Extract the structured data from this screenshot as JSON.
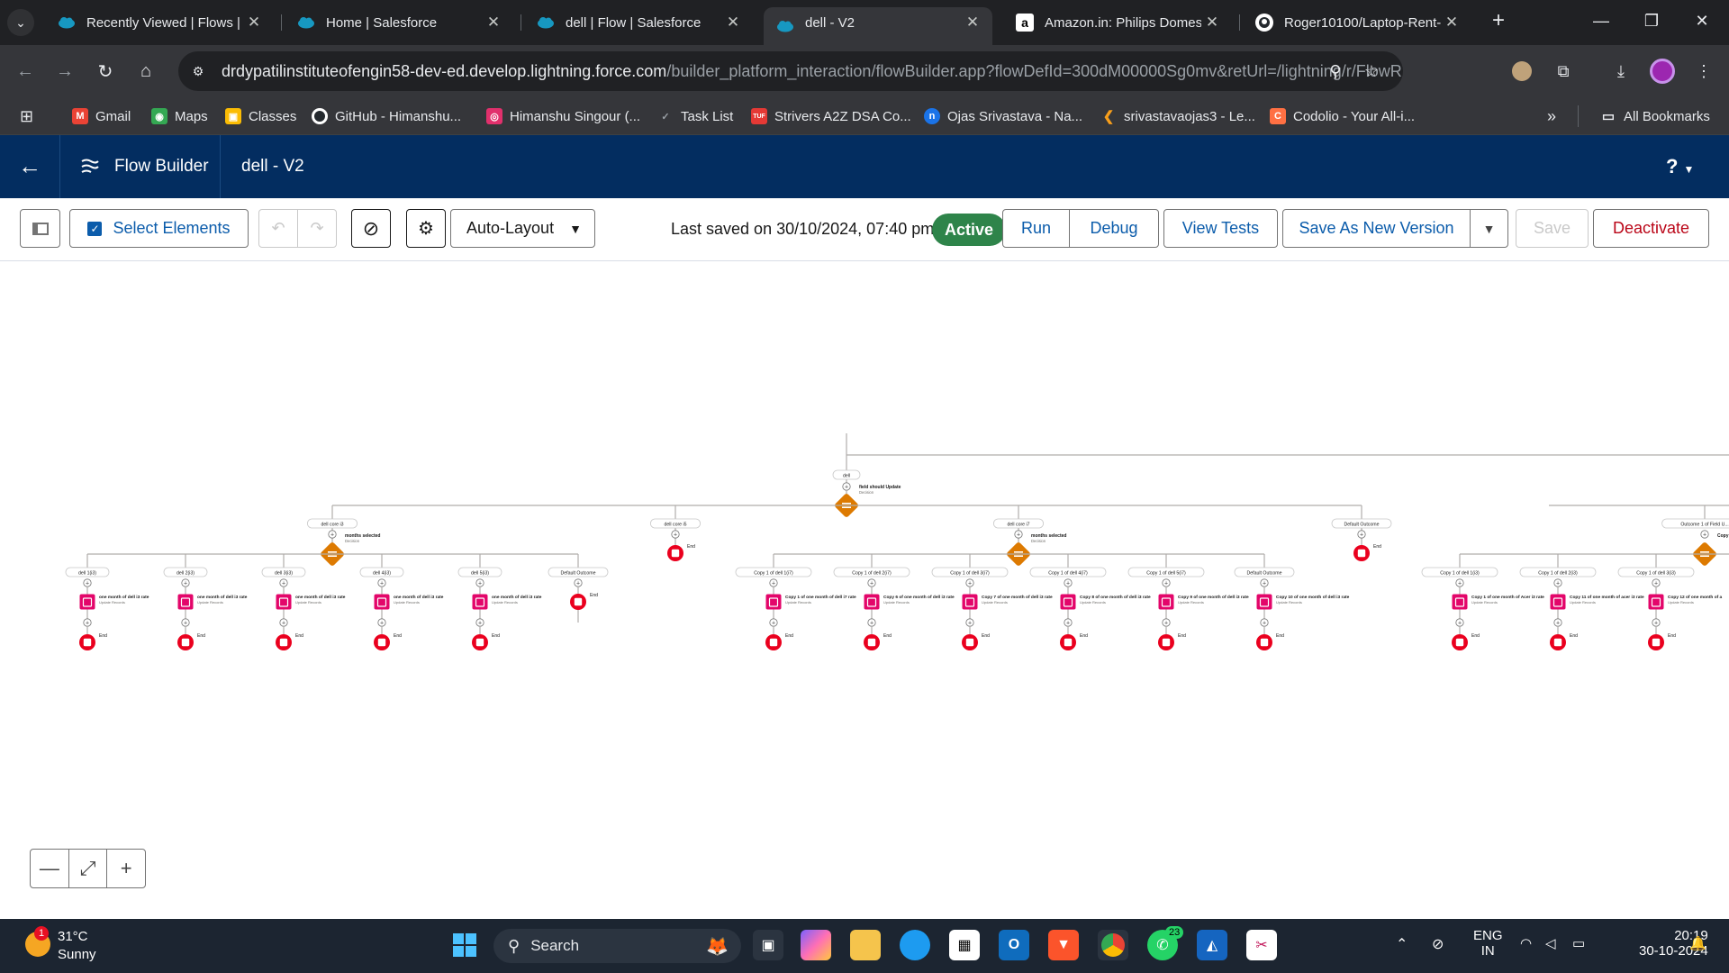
{
  "browser": {
    "tabs": [
      {
        "title": "Recently Viewed | Flows | S",
        "icon": "salesforce-cloud-icon"
      },
      {
        "title": "Home | Salesforce",
        "icon": "salesforce-cloud-icon"
      },
      {
        "title": "dell | Flow | Salesforce",
        "icon": "salesforce-cloud-icon"
      },
      {
        "title": "dell - V2",
        "icon": "salesforce-cloud-icon",
        "active": true
      },
      {
        "title": "Amazon.in: Philips Domesti",
        "icon": "amazon-icon"
      },
      {
        "title": "Roger10100/Laptop-Rent-",
        "icon": "github-icon"
      }
    ],
    "url_domain": "drdypatilinstituteofengin58-dev-ed.develop.lightning.force.com",
    "url_path": "/builder_platform_interaction/flowBuilder.app?flowDefId=300dM00000Sg0mv&retUrl=/lightning/r/FlowR...",
    "bookmarks": [
      {
        "label": "Gmail",
        "icon": "gmail-icon",
        "color": "#ea4335"
      },
      {
        "label": "Maps",
        "icon": "maps-icon",
        "color": "#34a853"
      },
      {
        "label": "Classes",
        "icon": "classes-icon",
        "color": "#fbbc04"
      },
      {
        "label": "GitHub - Himanshu...",
        "icon": "github-icon",
        "color": "#24292e"
      },
      {
        "label": "Himanshu Singour (...",
        "icon": "instagram-icon",
        "color": "#e1306c"
      },
      {
        "label": "Task List",
        "icon": "check-icon",
        "color": "#35363a"
      },
      {
        "label": "Strivers A2Z DSA Co...",
        "icon": "tuf-icon",
        "color": "#e53935"
      },
      {
        "label": "Ojas Srivastava - Na...",
        "icon": "naukri-icon",
        "color": "#1a73e8"
      },
      {
        "label": "srivastavaojas3 - Le...",
        "icon": "leetcode-icon",
        "color": "#f89f1b"
      },
      {
        "label": "Codolio - Your All-i...",
        "icon": "codolio-icon",
        "color": "#ff7043"
      }
    ],
    "all_bookmarks": "All Bookmarks"
  },
  "sf": {
    "app_title": "Flow Builder",
    "flow_name": "dell - V2",
    "help": "?"
  },
  "flowbar": {
    "select_elements": "Select Elements",
    "layout_mode": "Auto-Layout",
    "last_saved": "Last saved on 30/10/2024, 07:40 pm",
    "status": "Active",
    "run": "Run",
    "debug": "Debug",
    "view_tests": "View Tests",
    "save_as_new": "Save As New Version",
    "save": "Save",
    "deactivate": "Deactivate"
  },
  "flow": {
    "start_label": "dell",
    "root_decision": {
      "title": "field should Update",
      "subtitle": "Decision"
    },
    "branches": [
      {
        "label": "dell core i3",
        "decision": {
          "title": "months selected",
          "subtitle": "Decision"
        },
        "outcomes": [
          {
            "label": "dell 1(i3)",
            "title": "one month of dell i3 rate",
            "subtitle": "Update Records"
          },
          {
            "label": "dell 2(i3)",
            "title": "one month of dell i3 rate",
            "subtitle": "Update Records"
          },
          {
            "label": "dell 3(i3)",
            "title": "one month of dell i3 rate",
            "subtitle": "Update Records"
          },
          {
            "label": "dell 4(i3)",
            "title": "one month of dell i3 rate",
            "subtitle": "Update Records"
          },
          {
            "label": "dell 5(i3)",
            "title": "one month of dell i3 rate",
            "subtitle": "Update Records"
          },
          {
            "label": "Default Outcome",
            "title": "",
            "subtitle": ""
          }
        ]
      },
      {
        "label": "dell core i5",
        "decision": null,
        "outcomes": []
      },
      {
        "label": "dell core i7",
        "decision": {
          "title": "months selected",
          "subtitle": "Decision"
        },
        "outcomes": [
          {
            "label": "Copy 1 of dell 1(i7)",
            "title": "Copy 1 of one month of dell i7 rate",
            "subtitle": "Update Records"
          },
          {
            "label": "Copy 1 of dell 2(i7)",
            "title": "Copy 6 of one month of dell i3 rate",
            "subtitle": "Update Records"
          },
          {
            "label": "Copy 1 of dell 3(i7)",
            "title": "Copy 7 of one month of dell i3 rate",
            "subtitle": "Update Records"
          },
          {
            "label": "Copy 1 of dell 4(i7)",
            "title": "Copy 8 of one month of dell i3 rate",
            "subtitle": "Update Records"
          },
          {
            "label": "Copy 1 of dell 5(i7)",
            "title": "Copy 9 of one month of dell i3 rate",
            "subtitle": "Update Records"
          },
          {
            "label": "Default Outcome",
            "title": "Copy 10 of one month of dell i3 rate",
            "subtitle": "Update Records"
          }
        ]
      },
      {
        "label": "Default Outcome",
        "decision": null,
        "outcomes": []
      }
    ],
    "right_branch": {
      "label": "Outcome 1 of Field U...",
      "decision_title": "Copy",
      "outcomes": [
        {
          "label": "Copy 1 of dell 1(i3)",
          "title": "Copy 1 of one month of Acer i3 rate",
          "subtitle": "Update Records"
        },
        {
          "label": "Copy 1 of dell 2(i3)",
          "title": "Copy 11 of one month of acer i3 rate",
          "subtitle": "Update Records"
        },
        {
          "label": "Copy 1 of dell 3(i3)",
          "title": "Copy 12 of one month of a",
          "subtitle": "Update Records"
        }
      ]
    },
    "end_label": "End"
  },
  "zoom": {
    "minus": "—",
    "fit": "⤢",
    "plus": "+"
  },
  "taskbar": {
    "weather_temp": "31°C",
    "weather_desc": "Sunny",
    "weather_badge": "1",
    "search": "Search",
    "whatsapp_badge": "23",
    "lang_top": "ENG",
    "lang_bottom": "IN",
    "time": "20:19",
    "date": "30-10-2024"
  }
}
